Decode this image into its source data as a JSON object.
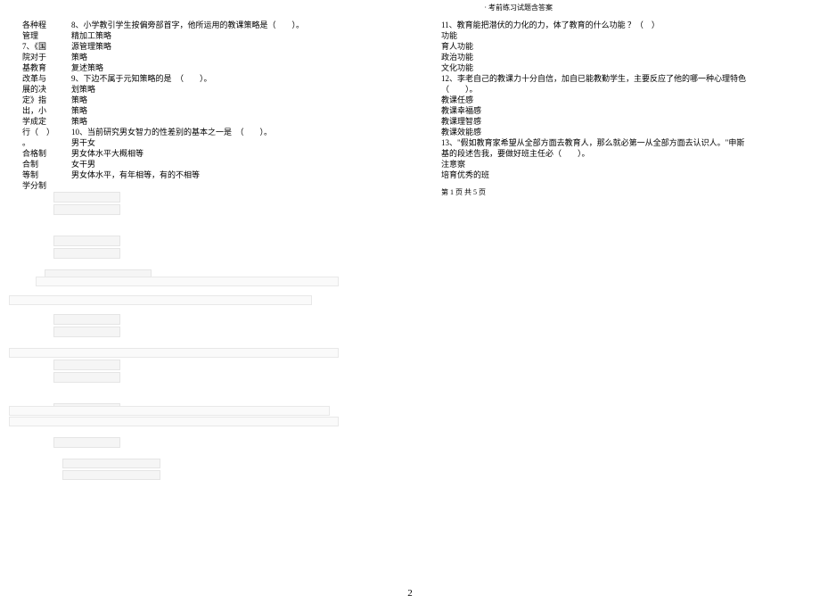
{
  "header": {
    "title": "· 考前练习试题含答案"
  },
  "left": {
    "rows": [
      {
        "label": "各种程",
        "content": "8、小学教引学生按偏旁部首字，他所运用的教课策略是（　　）。"
      },
      {
        "label": "管理",
        "content": "精加工策略"
      },
      {
        "label": "7、《国",
        "content": "源管理策略"
      },
      {
        "label": "院对于",
        "content": "策略"
      },
      {
        "label": "基教育",
        "content": "复述策略"
      },
      {
        "label": "改革与",
        "content": "9、下边不属于元知策略的是　（　　）。"
      },
      {
        "label": "展的决",
        "content": "划策略"
      },
      {
        "label": "定》指",
        "content": "策略"
      },
      {
        "label": "出，小",
        "content": "策略"
      },
      {
        "label": "学成定",
        "content": "策略"
      },
      {
        "label": "行（　）",
        "content": "10、当前研究男女智力的性差别的基本之一是　（　　）。"
      },
      {
        "label": "。",
        "content": "男干女"
      },
      {
        "label": "合格制",
        "content": "男女体水平大概相等"
      },
      {
        "label": "合制",
        "content": "女干男"
      },
      {
        "label": "等制",
        "content": "男女体水平，有年相等，有的不相等"
      },
      {
        "label": "学分制",
        "content": ""
      }
    ]
  },
  "right": {
    "lines": [
      "11、教育能把潜伏的力化的力，体了教育的什么功能 ？（　）",
      "功能",
      "育人功能",
      "政治功能",
      "文化功能",
      "12、李老自己的教课力十分自信，加自已能教勤学生，主要反应了他的哪一种心理特色",
      "（　　）。",
      "教课任感",
      "教课幸福感",
      "教课理智感",
      "教课效能感",
      "13、\"假如教育家希望从全部方面去教育人，那么就必第一从全部方面去认识人。\"申斯",
      "基的段述告我，要做好班主任必（　　）。",
      "注意察",
      "培育优秀的班"
    ]
  },
  "footer": {
    "page_indicator": "第 1 页 共 5 页",
    "page_number": "2"
  }
}
